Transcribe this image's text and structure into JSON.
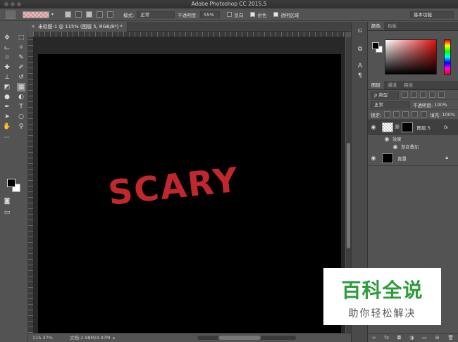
{
  "app": {
    "title": "Adobe Photoshop CC 2015.5"
  },
  "options": {
    "mode_label": "模式:",
    "mode_value": "正常",
    "opacity_label": "不透明度:",
    "opacity_value": "55%",
    "reverse_label": "反向",
    "dither_label": "仿色",
    "transparency_label": "透明区域",
    "workspace": "基本功能"
  },
  "document": {
    "tab_label": "未标题-1 @ 115% (图层 5, RGB/8*) *"
  },
  "canvas": {
    "text": "SCARY",
    "text_color": "#c0282d"
  },
  "status": {
    "zoom": "115.37%",
    "doc_info": "文档:2.98M/4.97M"
  },
  "panels": {
    "color_tab": "颜色",
    "swatches_tab": "色板",
    "layers_tab": "图层",
    "channels_tab": "通道",
    "paths_tab": "路径",
    "filter_label": "ρ 类型",
    "blend_mode": "正常",
    "opacity_label": "不透明度:",
    "opacity_value": "100%",
    "lock_label": "锁定:",
    "fill_label": "填充:",
    "fill_value": "100%",
    "layers": [
      {
        "name": "图层 5",
        "fx": "fx"
      },
      {
        "name": "背景"
      }
    ],
    "effects_label": "效果",
    "gradient_overlay_label": "渐变叠加"
  },
  "watermark": {
    "title": "百科全说",
    "subtitle": "助你轻松解决"
  }
}
